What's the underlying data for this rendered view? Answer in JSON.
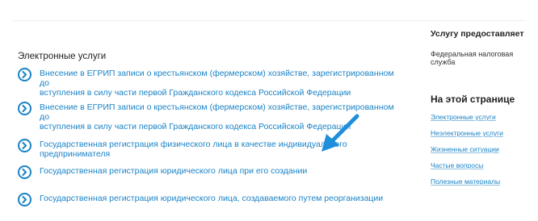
{
  "main": {
    "section_title": "Электронные услуги",
    "services": [
      {
        "line1": "Внесение в ЕГРИП записи о крестьянском (фермерском) хозяйстве, зарегистрированном до",
        "line2": "вступления в силу части первой Гражданского кодекса Российской Федерации"
      },
      {
        "line1": "Внесение в ЕГРИП записи о крестьянском (фермерском) хозяйстве, зарегистрированном до",
        "line2": "вступления в силу части первой Гражданского кодекса Российской Федерации"
      },
      {
        "line1": "Государственная регистрация физического лица в качестве индивидуального предпринимателя",
        "line2": ""
      },
      {
        "line1": "Государственная регистрация юридического лица при его создании",
        "line2": ""
      },
      {
        "line1": "Государственная регистрация юридического лица, создаваемого путем реорганизации",
        "line2": ""
      }
    ]
  },
  "sidebar": {
    "provider_heading": "Услугу предоставляет",
    "provider_name": "Федеральная налоговая служба",
    "onpage_heading": "На этой странице",
    "links": [
      "Электронные услуги",
      "Неэлектронные услуги",
      "Жизненные ситуации",
      "Частые вопросы",
      "Полезные материалы"
    ]
  },
  "icons": {
    "service_icon": "chevron-right-circle-icon",
    "pointer": "arrow-icon"
  },
  "colors": {
    "link": "#1a83c6",
    "arrow": "#1f8fdb"
  }
}
